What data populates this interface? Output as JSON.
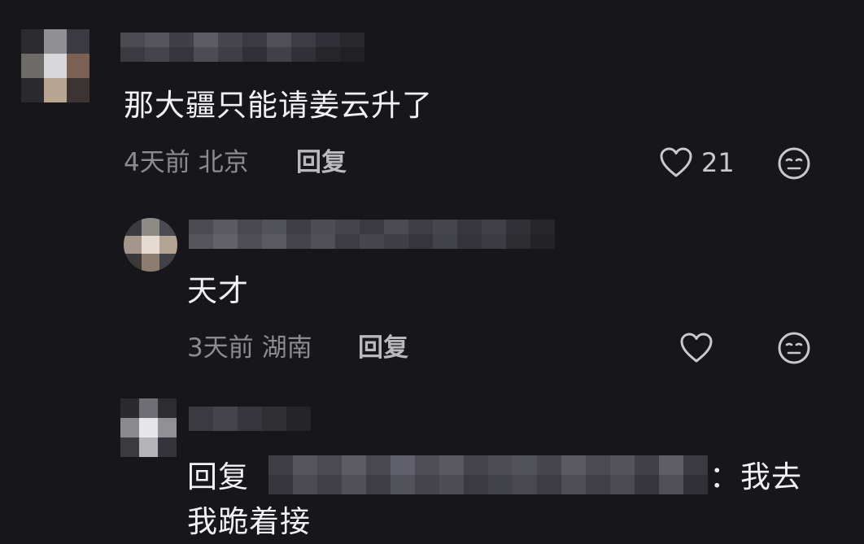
{
  "comments": [
    {
      "text": "那大疆只能请姜云升了",
      "time": "4天前",
      "location": "北京",
      "reply_label": "回复",
      "likes": "21"
    },
    {
      "text": "天才",
      "time": "3天前",
      "location": "湖南",
      "reply_label": "回复",
      "likes": ""
    },
    {
      "reply_prefix": "回复",
      "reply_suffix": "：我去",
      "text_line2": "我跪着接"
    }
  ],
  "icons": {
    "like": "heart-outline-icon",
    "dislike": "meh-face-icon"
  },
  "colors": {
    "background": "#16161b",
    "text": "#f2f2f4",
    "meta": "#8b8b92",
    "icon": "#c8c8cd"
  }
}
